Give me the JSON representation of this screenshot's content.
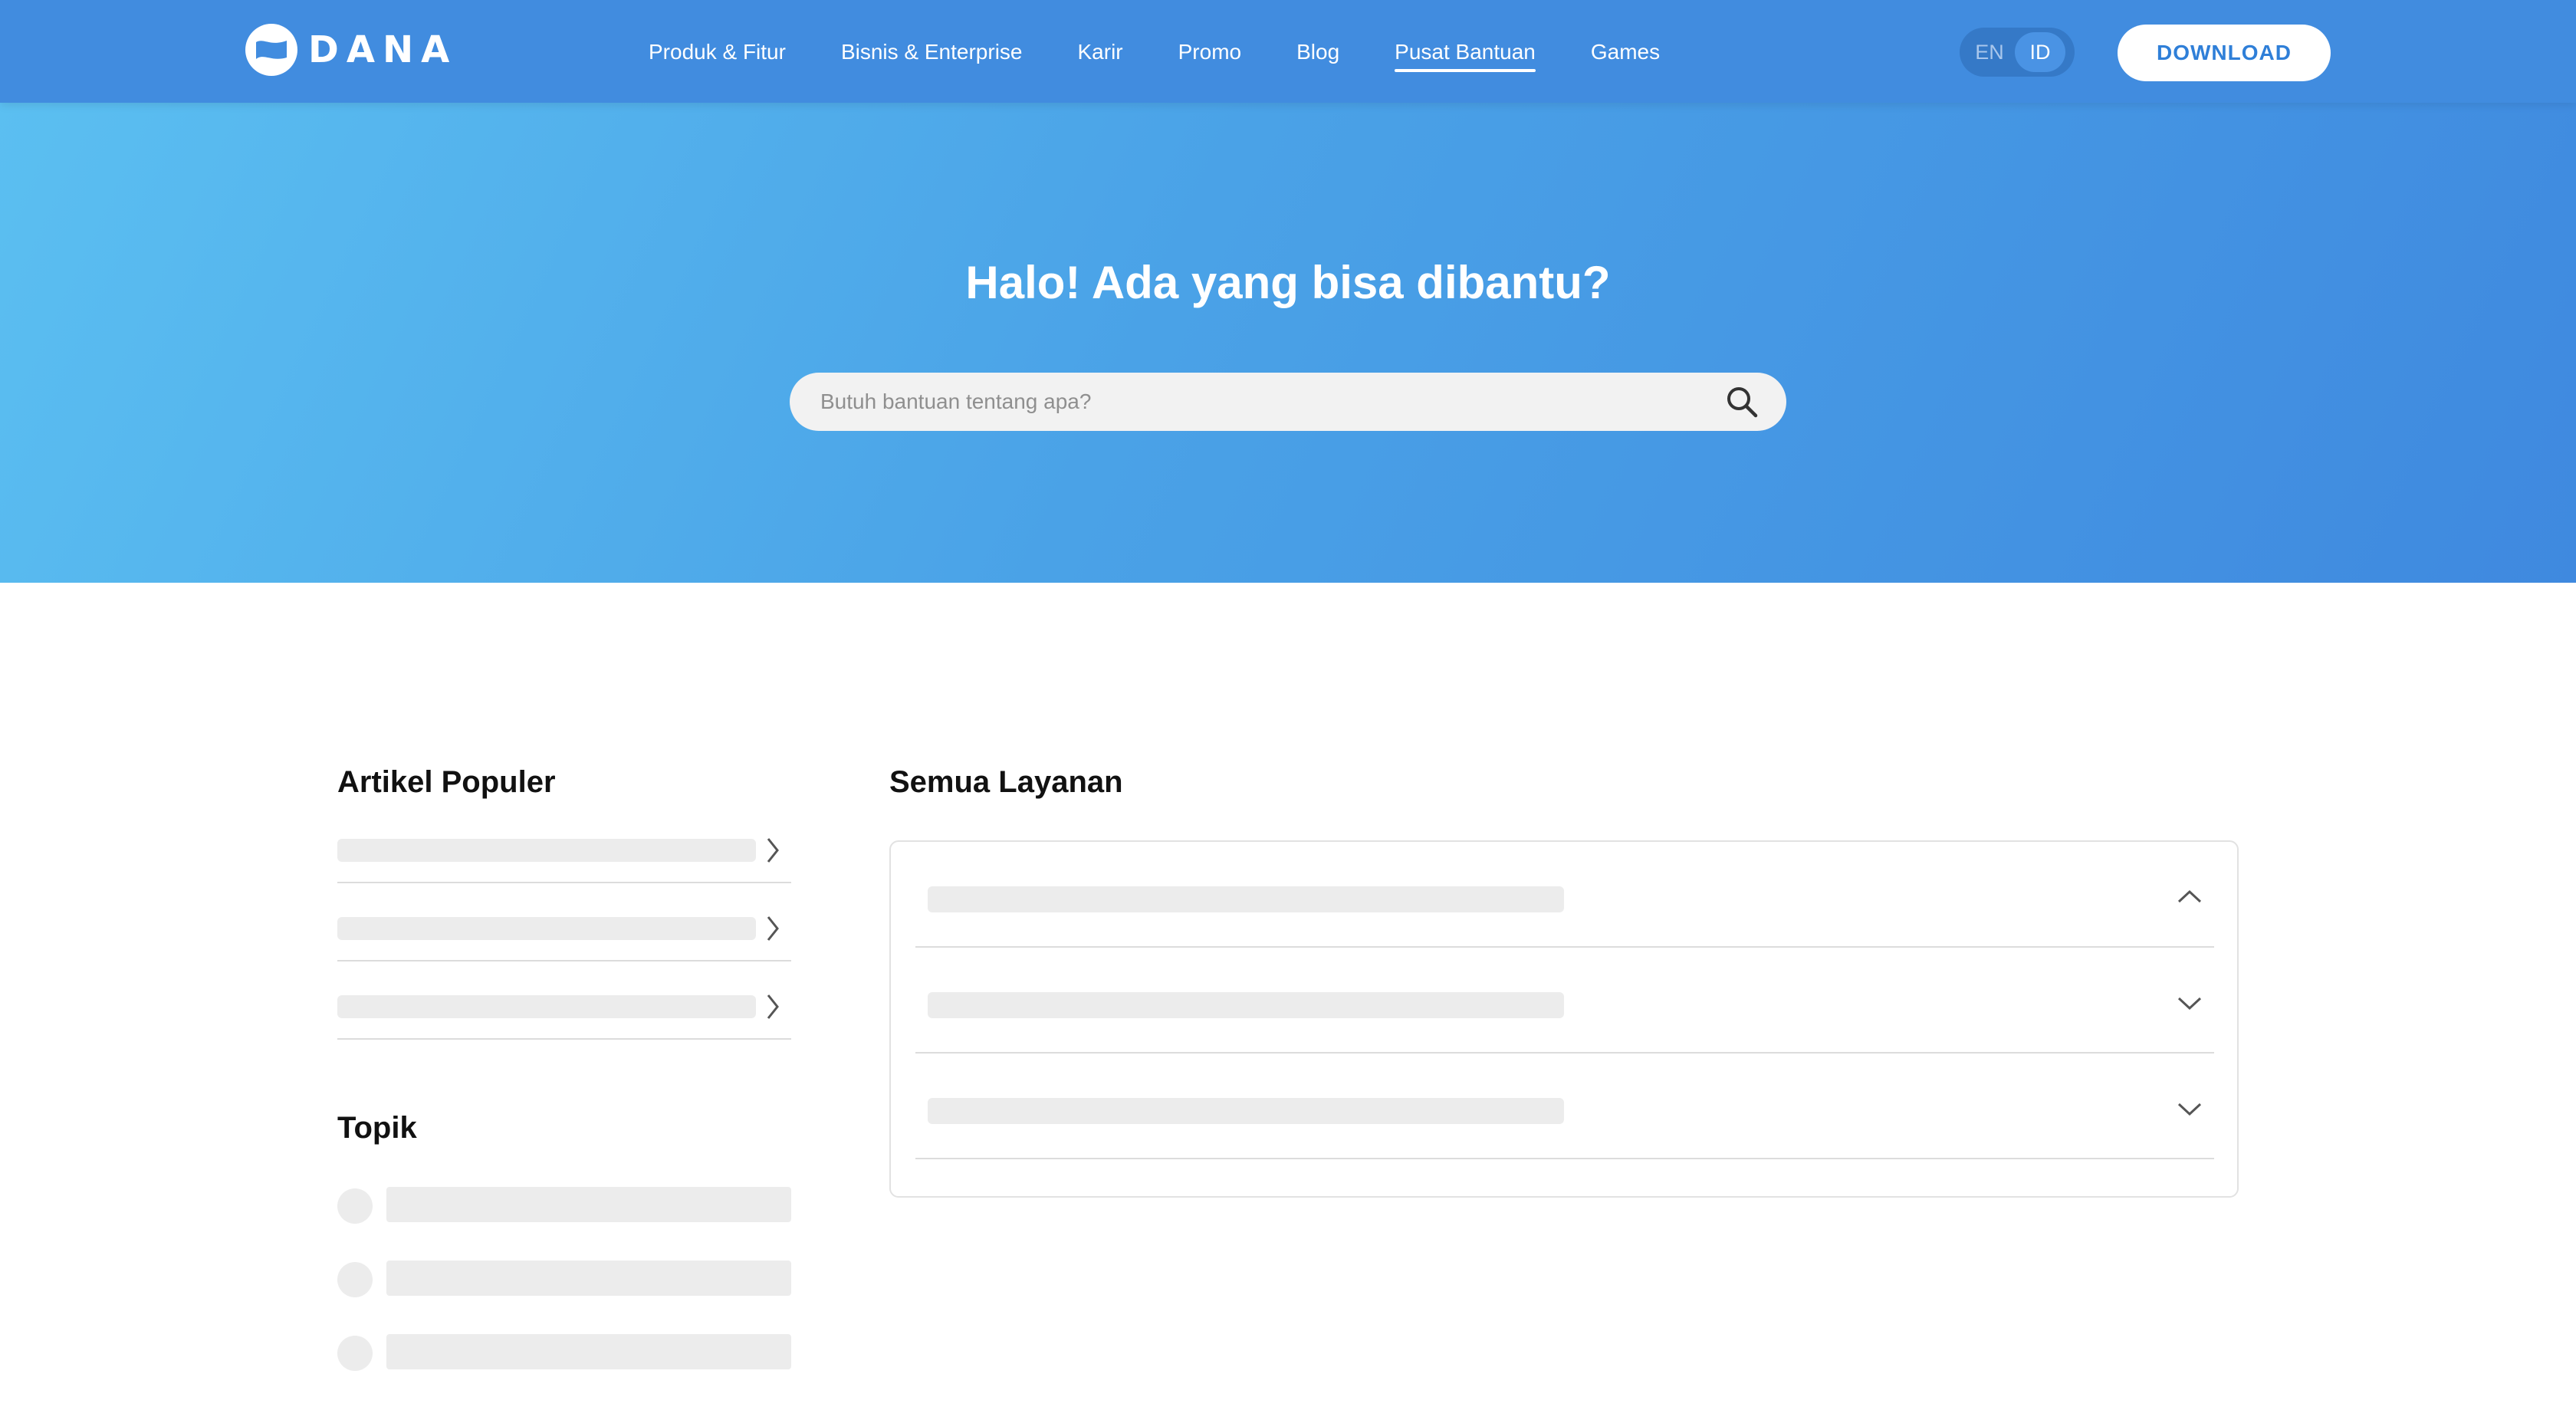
{
  "header": {
    "logo_text": "DANA",
    "nav": [
      {
        "label": "Produk & Fitur"
      },
      {
        "label": "Bisnis & Enterprise"
      },
      {
        "label": "Karir"
      },
      {
        "label": "Promo"
      },
      {
        "label": "Blog"
      },
      {
        "label": "Pusat Bantuan",
        "active": true
      },
      {
        "label": "Games"
      }
    ],
    "lang": {
      "options": [
        "EN",
        "ID"
      ],
      "selected": "ID"
    },
    "download_label": "DOWNLOAD"
  },
  "hero": {
    "title": "Halo! Ada yang bisa dibantu?",
    "search_placeholder": "Butuh bantuan tentang apa?",
    "search_value": ""
  },
  "popular": {
    "title": "Artikel Populer"
  },
  "topics": {
    "title": "Topik"
  },
  "services": {
    "title": "Semua Layanan"
  },
  "colors": {
    "brand": "#418cdf",
    "hero_start": "#5bbff1",
    "hero_end": "#3f89df",
    "skeleton": "#ececec"
  },
  "icons": {
    "logo": "dana-logo-icon",
    "search": "search-icon",
    "chevron_right": "chevron-right-icon",
    "chevron_up": "chevron-up-icon",
    "chevron_down": "chevron-down-icon"
  }
}
